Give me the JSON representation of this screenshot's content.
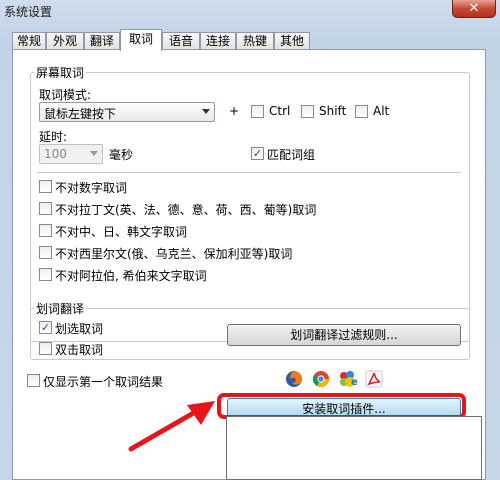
{
  "window": {
    "title": "系统设置",
    "close_glyph": "✕"
  },
  "tabs": [
    {
      "label": "常规"
    },
    {
      "label": "外观"
    },
    {
      "label": "翻译"
    },
    {
      "label": "取词"
    },
    {
      "label": "语音"
    },
    {
      "label": "连接"
    },
    {
      "label": "热键"
    },
    {
      "label": "其他"
    }
  ],
  "active_tab": "取词",
  "screen_pick": {
    "group_title": "屏幕取词",
    "mode_label": "取词模式:",
    "mode_value": "鼠标左键按下",
    "plus": "+",
    "ctrl": {
      "label": "Ctrl",
      "checked": false
    },
    "shift": {
      "label": "Shift",
      "checked": false
    },
    "alt": {
      "label": "Alt",
      "checked": false
    },
    "delay_label": "延时:",
    "delay_value": "100",
    "delay_unit": "毫秒",
    "match_phrase": {
      "label": "匹配词组",
      "checked": true
    },
    "options": [
      {
        "label": "不对数字取词",
        "checked": false
      },
      {
        "label": "不对拉丁文(英、法、德、意、荷、西、葡等)取词",
        "checked": false
      },
      {
        "label": "不对中、日、韩文字取词",
        "checked": false
      },
      {
        "label": "不对西里尔文(俄、乌克兰、保加利亚等)取词",
        "checked": false
      },
      {
        "label": "不对阿拉伯, 希伯来文字取词",
        "checked": false
      }
    ]
  },
  "selection_translate": {
    "group_title": "划词翻译",
    "select_pick": {
      "label": "划选取词",
      "checked": true
    },
    "double_click": {
      "label": "双击取词",
      "checked": false
    },
    "filter_rules_button": "划词翻译过滤规则..."
  },
  "only_first_result": {
    "label": "仅显示第一个取词结果",
    "checked": false
  },
  "browser_icons": [
    "firefox-icon",
    "chrome-icon",
    "ie-maxthon-icon",
    "acrobat-icon"
  ],
  "install_plugin_button": "安装取词插件...",
  "colors": {
    "highlight": "#e8141c",
    "arrow": "#e8141c"
  }
}
